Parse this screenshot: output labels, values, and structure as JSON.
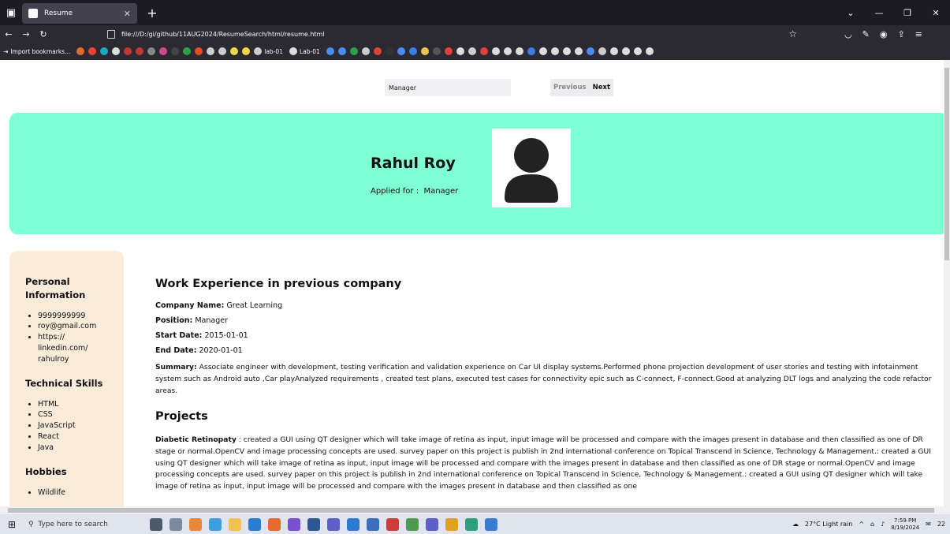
{
  "browser": {
    "tab_title": "Resume",
    "url": "file:///D:/gi/github/11AUG2024/ResumeSearch/html/resume.html",
    "bookmarks_label": "Import bookmarks...",
    "bookmark_labels": [
      "lab-01",
      "Lab-01"
    ]
  },
  "search": {
    "value": "Manager",
    "prev_label": "Previous",
    "next_label": "Next"
  },
  "header": {
    "name": "Rahul Roy",
    "applied_label": "Applied for :",
    "applied_value": "Manager"
  },
  "sidebar": {
    "personal_title": "Personal Information",
    "personal": [
      "9999999999",
      "roy@gmail.com",
      "https://\nlinkedin.com/\nrahulroy"
    ],
    "skills_title": "Technical Skills",
    "skills": [
      "HTML",
      "CSS",
      "JavaScript",
      "React",
      "Java"
    ],
    "hobbies_title": "Hobbies",
    "hobbies": [
      "Wildlife"
    ]
  },
  "work": {
    "title": "Work Experience in previous company",
    "company_label": "Company Name:",
    "company": "Great Learning",
    "position_label": "Position:",
    "position": "Manager",
    "start_label": "Start Date:",
    "start": "2015-01-01",
    "end_label": "End Date:",
    "end": "2020-01-01",
    "summary_label": "Summary:",
    "summary": "Associate engineer with development, testing verification and validation experience on Car UI display systems.Performed phone projection development of user stories and testing with infotainment system such as Android auto ,Car playAnalyzed requirements , created test plans, executed test cases for connectivity epic such as C-connect, F-connect.Good at analyzing DLT logs and analyzing the code refactor areas."
  },
  "projects": {
    "title": "Projects",
    "name": "Diabetic Retinopaty",
    "text": ": created a GUI using QT designer which will take image of retina as input, input image will be processed and compare with the images present in database and then classified as one of DR stage or normal.OpenCV and image processing concepts are used. survey paper on this project is publish in 2nd international conference on Topical Transcend in Science, Technology & Management.: created a GUI using QT designer which will take image of retina as input, input image will be processed and compare with the images present in database and then classified as one of DR stage or normal.OpenCV and image processing concepts are used. survey paper on this project is publish in 2nd international conference on Topical Transcend in Science, Technology & Management.: created a GUI using QT designer which will take image of retina as input, input image will be processed and compare with the images present in database and then classified as one"
  },
  "taskbar": {
    "search_placeholder": "Type here to search",
    "weather": "27°C  Light rain",
    "time": "7:59 PM",
    "date": "8/19/2024",
    "notifications": "22"
  }
}
